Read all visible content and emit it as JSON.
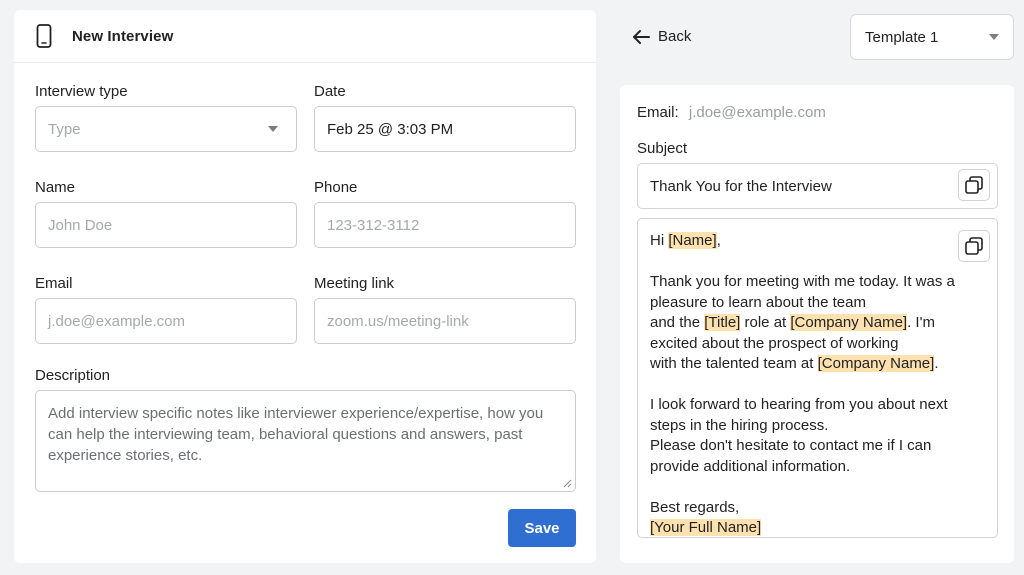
{
  "form": {
    "title": "New Interview",
    "interview_type": {
      "label": "Interview type",
      "placeholder": "Type"
    },
    "date": {
      "label": "Date",
      "value": "Feb 25 @ 3:03 PM"
    },
    "name": {
      "label": "Name",
      "placeholder": "John Doe"
    },
    "phone": {
      "label": "Phone",
      "placeholder": "123-312-3112"
    },
    "email": {
      "label": "Email",
      "placeholder": "j.doe@example.com"
    },
    "meeting_link": {
      "label": "Meeting link",
      "placeholder": "zoom.us/meeting-link"
    },
    "description": {
      "label": "Description",
      "placeholder_lines": [
        "Add interview specific notes like interviewer experience/expertise, how you",
        "can help the interviewing team, behavioral questions and answers, past",
        "experience stories, etc."
      ]
    },
    "save_label": "Save"
  },
  "nav": {
    "back_label": "Back"
  },
  "template": {
    "selected": "Template 1"
  },
  "preview": {
    "email_label": "Email:",
    "email_value": "j.doe@example.com",
    "subject_label": "Subject",
    "subject_value": "Thank You for the Interview",
    "body": {
      "greeting_prefix": "Hi ",
      "name_tag": "[Name]",
      "greeting_suffix": ",",
      "p1_line1": "Thank you for meeting with me today. It was a",
      "p1_line2": "pleasure to learn about the team",
      "p1_line3_a": "and the ",
      "title_tag": "[Title]",
      "p1_line3_b": " role at ",
      "company_tag": "[Company Name]",
      "p1_line3_c": ". I'm",
      "p1_line4": "excited about the prospect of working",
      "p1_line5_a": "with the talented team at ",
      "p1_line5_b": ".",
      "p2_line1": "I look forward to hearing from you about next",
      "p2_line2": "steps in the hiring process.",
      "p2_line3": "Please don't hesitate to contact me if I can",
      "p2_line4": "provide additional information.",
      "closing": "Best regards,",
      "signature_tag": "[Your Full Name]"
    }
  },
  "icons": {
    "header": "mobile-phone-icon",
    "back": "arrow-left-icon",
    "dropdown": "caret-down-icon",
    "copy": "copy-icon"
  },
  "colors": {
    "accent": "#2f6fd1",
    "highlight": "#fde2b0",
    "background": "#f2f3f5"
  }
}
